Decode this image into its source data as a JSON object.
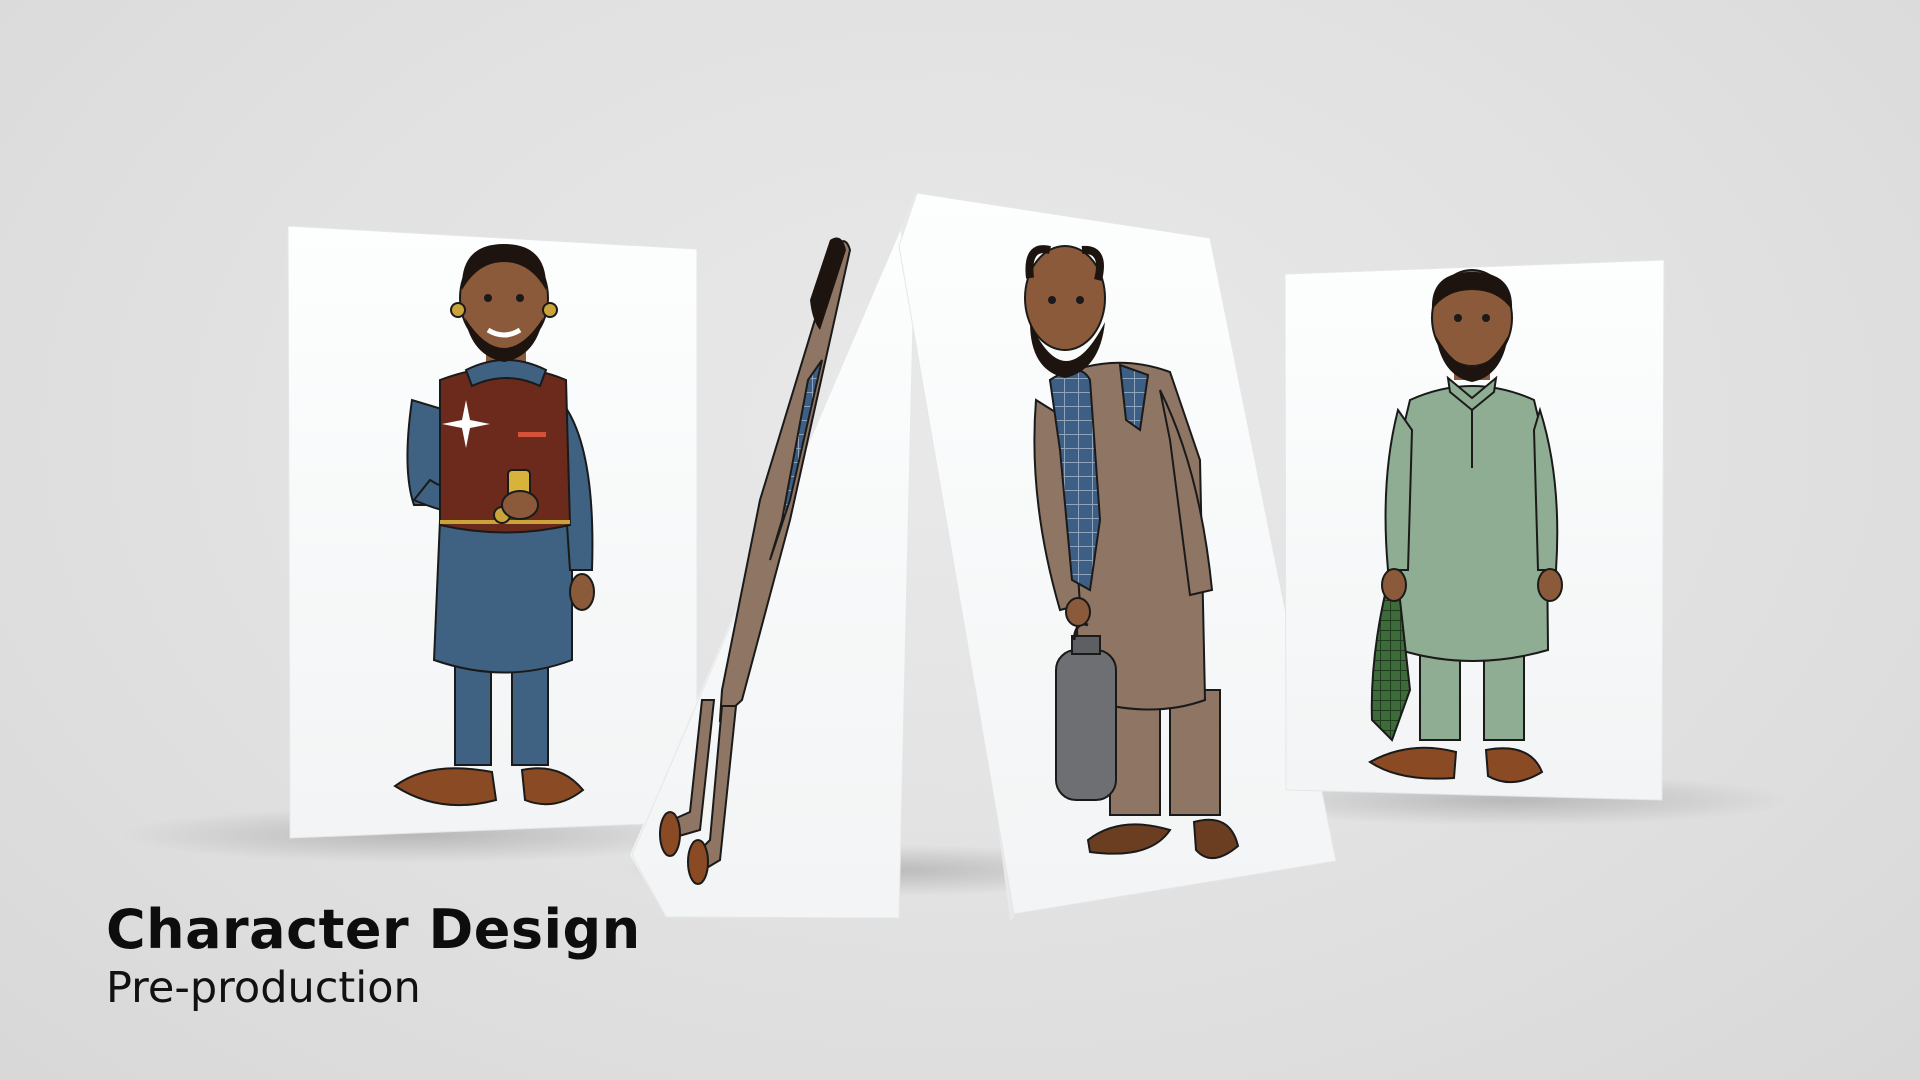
{
  "caption": {
    "title": "Character Design",
    "subtitle": "Pre-production"
  },
  "cards": [
    {
      "character": "man in blue kurta with brown waistcoat holding phone"
    },
    {
      "character": "side view of man in brown kurta with blue checked scarf"
    },
    {
      "character": "bald man in brown kurta with blue checked scarf holding bottle"
    },
    {
      "character": "man in green kurta holding green checked cloth"
    }
  ],
  "colors": {
    "background": "#e1e1e1",
    "card": "#fbfcfc",
    "skin": "#8a5a3a",
    "beard": "#1d1410",
    "blue_kurta": "#3f6282",
    "waistcoat": "#6b2a1c",
    "brown_kurta": "#8f7563",
    "scarf_blue": "#3d5f86",
    "green_kurta": "#8fad92",
    "green_cloth": "#3e6b3a",
    "sandal": "#8a4a24",
    "bottle": "#6d6f72"
  }
}
